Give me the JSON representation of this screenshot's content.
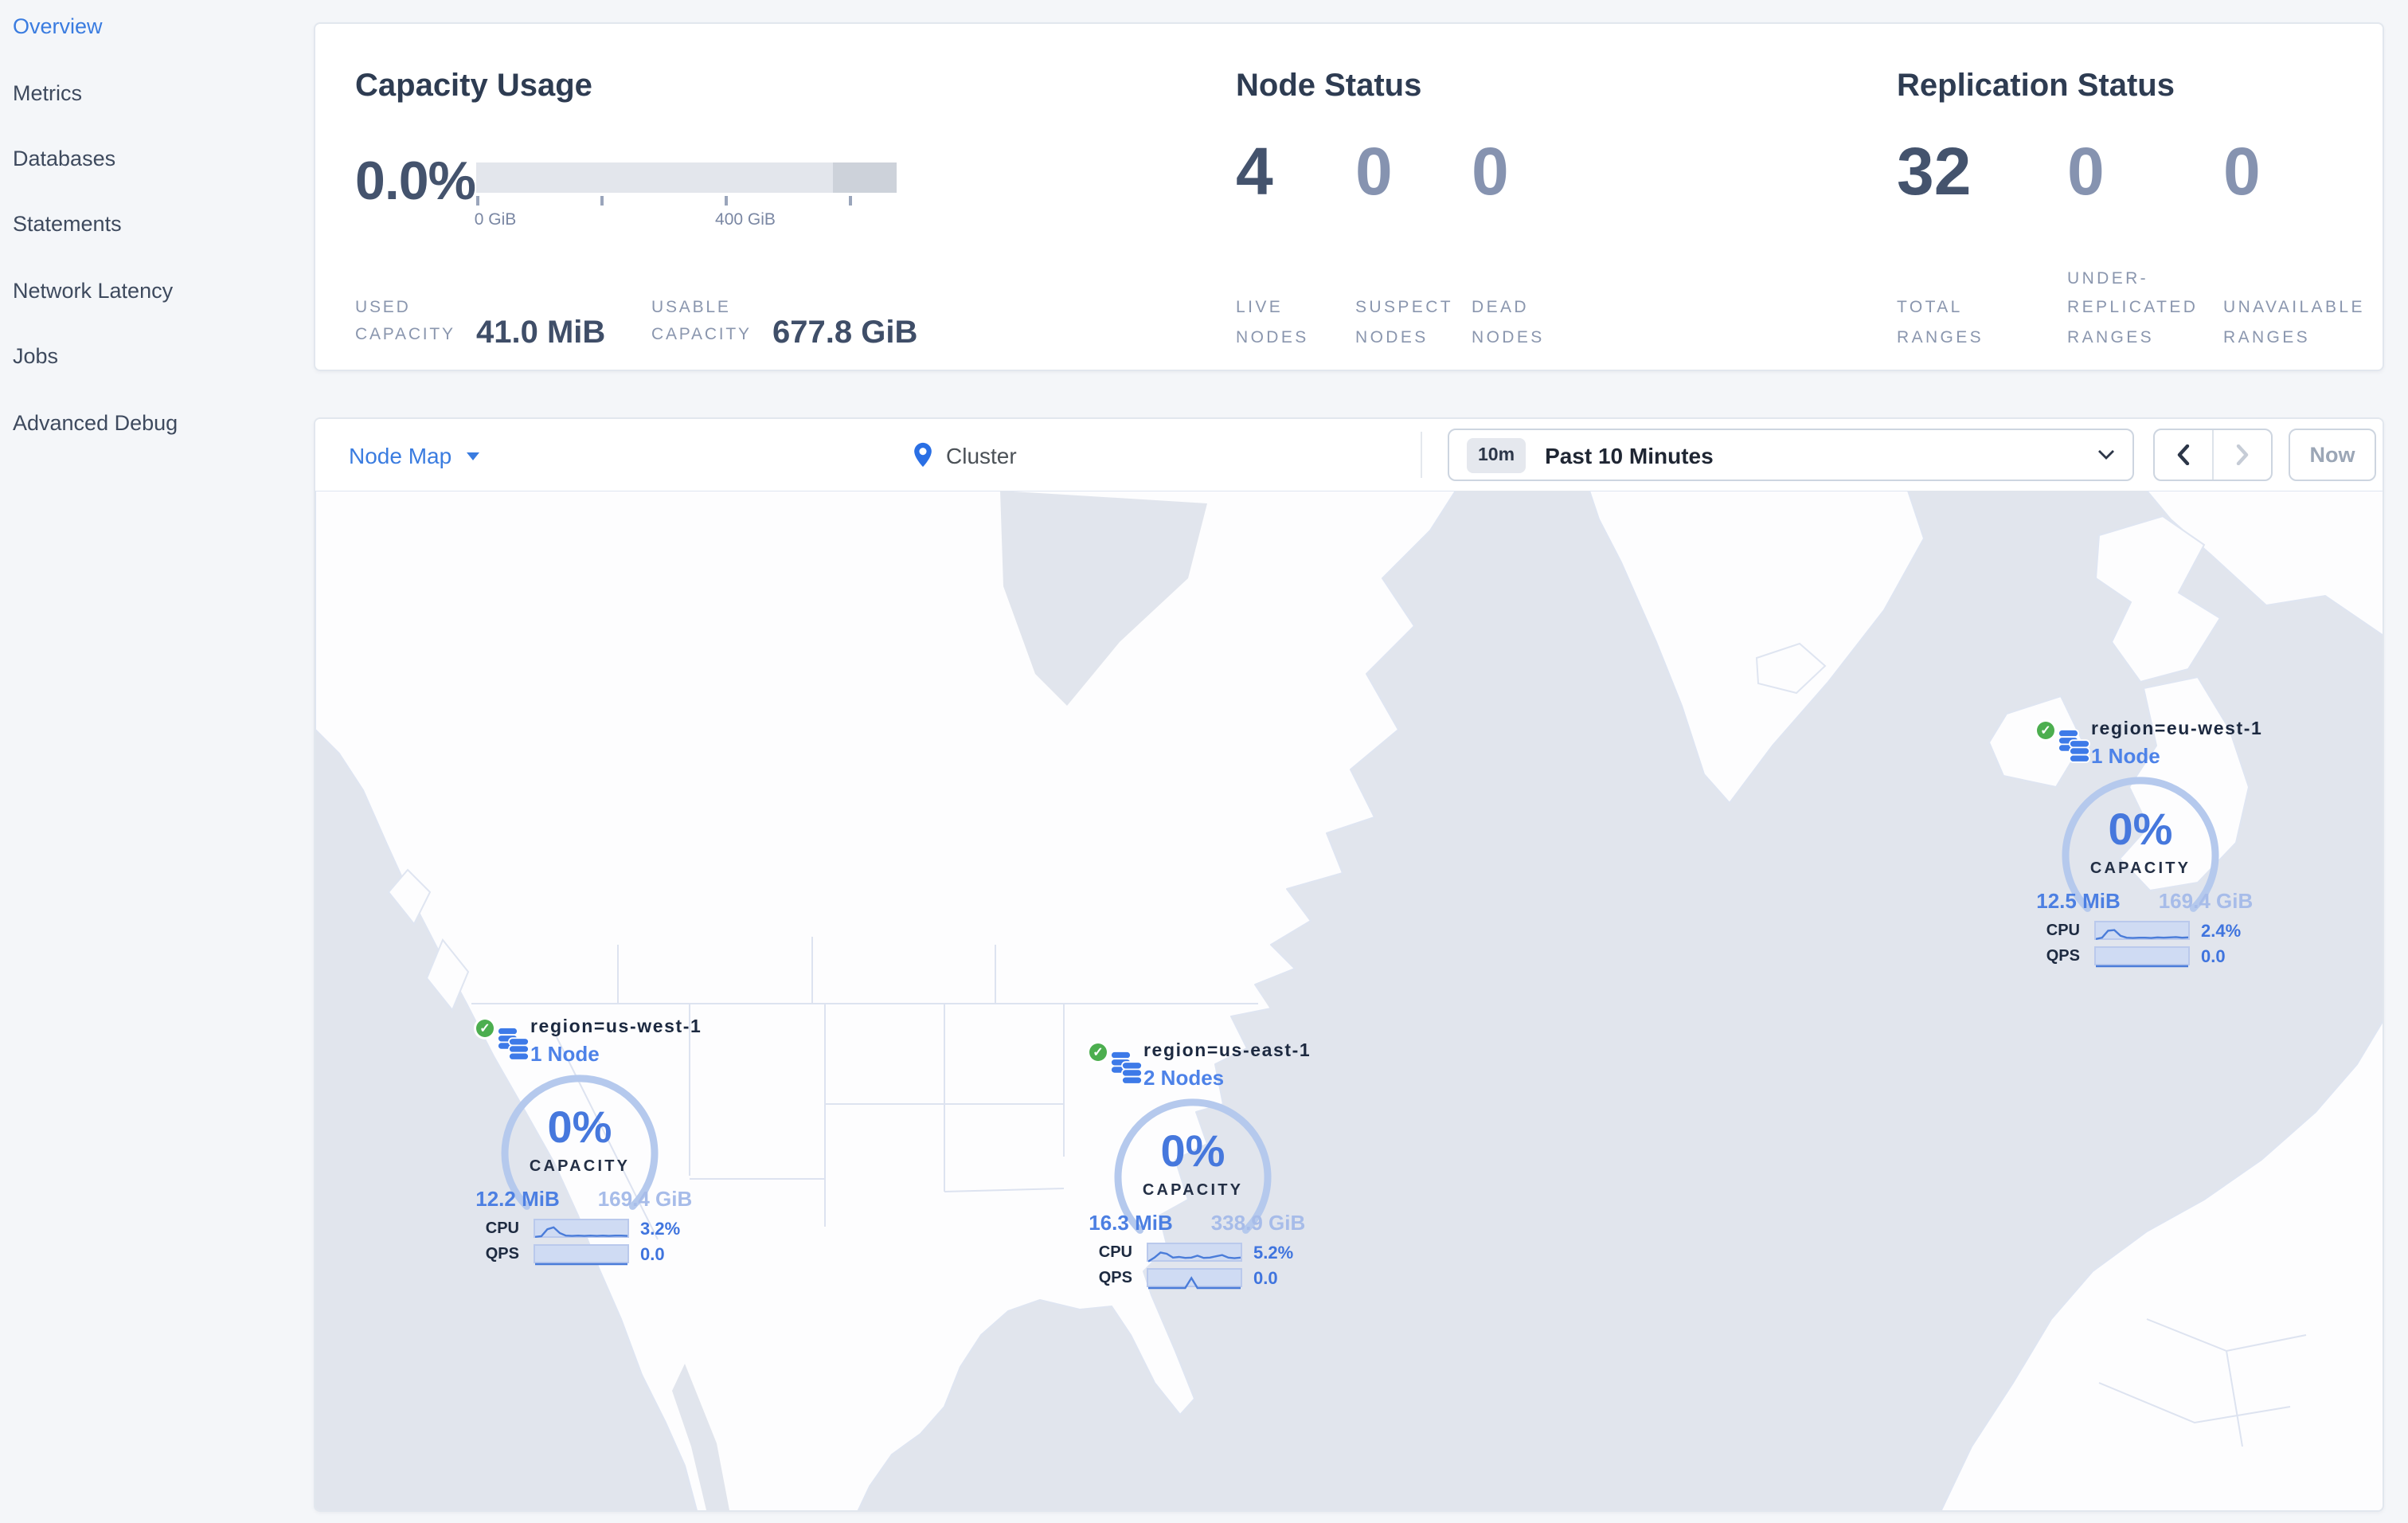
{
  "sidebar": {
    "items": [
      {
        "label": "Overview",
        "active": true
      },
      {
        "label": "Metrics",
        "active": false
      },
      {
        "label": "Databases",
        "active": false
      },
      {
        "label": "Statements",
        "active": false
      },
      {
        "label": "Network Latency",
        "active": false
      },
      {
        "label": "Jobs",
        "active": false
      },
      {
        "label": "Advanced Debug",
        "active": false
      }
    ]
  },
  "summary": {
    "capacity": {
      "title": "Capacity Usage",
      "percent": "0.0%",
      "tick_labels": [
        "0 GiB",
        "400 GiB"
      ],
      "used_label": "USED CAPACITY",
      "used_value": "41.0 MiB",
      "usable_label": "USABLE CAPACITY",
      "usable_value": "677.8 GiB"
    },
    "nodes": {
      "title": "Node Status",
      "stats": [
        {
          "value": "4",
          "label": "LIVE NODES"
        },
        {
          "value": "0",
          "label": "SUSPECT NODES"
        },
        {
          "value": "0",
          "label": "DEAD NODES"
        }
      ]
    },
    "replication": {
      "title": "Replication Status",
      "stats": [
        {
          "value": "32",
          "label": "TOTAL RANGES"
        },
        {
          "value": "0",
          "label": "UNDER-REPLICATED RANGES"
        },
        {
          "value": "0",
          "label": "UNAVAILABLE RANGES"
        }
      ]
    }
  },
  "toolbar": {
    "view_label": "Node Map",
    "breadcrumb": "Cluster",
    "time_badge": "10m",
    "time_label": "Past 10 Minutes",
    "now_label": "Now"
  },
  "map": {
    "labels": {
      "capacity": "CAPACITY",
      "cpu": "CPU",
      "qps": "QPS"
    },
    "regions": [
      {
        "name": "region=us-west-1",
        "nodes": "1 Node",
        "capacity_percent": "0%",
        "used": "12.2 MiB",
        "total": "169.4 GiB",
        "cpu": "3.2%",
        "qps": "0.0",
        "cpu_spark": [
          0.2,
          0.25,
          0.8,
          0.95,
          0.5,
          0.3,
          0.27,
          0.3,
          0.28,
          0.3,
          0.27,
          0.3,
          0.28,
          0.3,
          0.3,
          0.28
        ],
        "qps_spark": [
          0.06,
          0.06,
          0.06,
          0.06,
          0.06,
          0.06,
          0.06,
          0.06,
          0.06,
          0.06,
          0.06,
          0.06,
          0.06,
          0.06,
          0.06,
          0.06
        ]
      },
      {
        "name": "region=us-east-1",
        "nodes": "2 Nodes",
        "capacity_percent": "0%",
        "used": "16.3 MiB",
        "total": "338.9 GiB",
        "cpu": "5.2%",
        "qps": "0.0",
        "cpu_spark": [
          0.15,
          0.45,
          0.85,
          0.75,
          0.45,
          0.5,
          0.42,
          0.45,
          0.6,
          0.42,
          0.45,
          0.55,
          0.65,
          0.45,
          0.4,
          0.45
        ],
        "qps_spark": [
          0.06,
          0.06,
          0.06,
          0.06,
          0.06,
          0.06,
          0.06,
          0.85,
          0.06,
          0.06,
          0.06,
          0.06,
          0.06,
          0.06,
          0.06,
          0.06
        ]
      },
      {
        "name": "region=eu-west-1",
        "nodes": "1 Node",
        "capacity_percent": "0%",
        "used": "12.5 MiB",
        "total": "169.4 GiB",
        "cpu": "2.4%",
        "qps": "0.0",
        "cpu_spark": [
          0.2,
          0.3,
          0.85,
          0.9,
          0.45,
          0.3,
          0.28,
          0.3,
          0.3,
          0.28,
          0.32,
          0.3,
          0.33,
          0.35,
          0.3,
          0.32
        ],
        "qps_spark": [
          0.06,
          0.06,
          0.06,
          0.06,
          0.06,
          0.06,
          0.06,
          0.06,
          0.06,
          0.06,
          0.06,
          0.06,
          0.06,
          0.06,
          0.06,
          0.06
        ]
      }
    ]
  },
  "colors": {
    "accent_blue": "#3a7ce0",
    "healthy_green": "#4cae4f",
    "ocean": "#e1e5ed",
    "land": "#fdfdfe",
    "arc_ring": "#b5c9ed",
    "spark_line": "#4a7cd9"
  }
}
